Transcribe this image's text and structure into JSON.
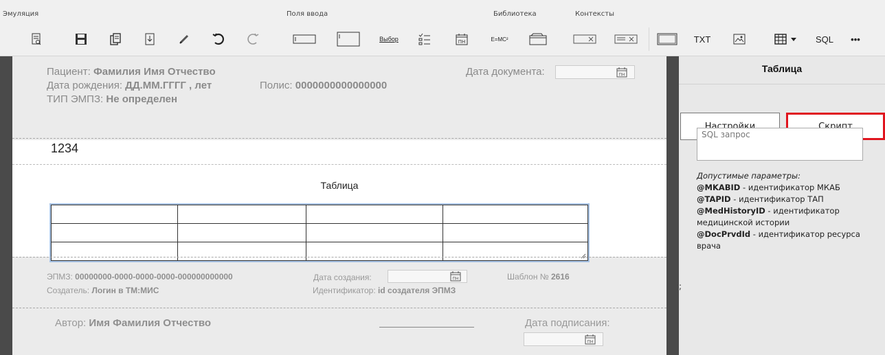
{
  "toolbar": {
    "groups": {
      "emulation": "Эмуляция",
      "input_fields": "Поля ввода",
      "library": "Библиотека",
      "contexts": "Контексты"
    },
    "choice_label": "Выбор",
    "formula_label": "E=MC²",
    "txt_label": "TXT",
    "sql_label": "SQL",
    "more_label": "•••",
    "calendar_glyph": "ПН"
  },
  "document": {
    "patient_label": "Пациент:",
    "patient_value": "Фамилия Имя Отчество",
    "birth_label": "Дата рождения:",
    "birth_value": "ДД.ММ.ГГГГ , лет",
    "policy_label": "Полис:",
    "policy_value": "0000000000000000",
    "emz_type_label": "ТИП ЭМПЗ:",
    "emz_type_value": "Не определен",
    "doc_date_label": "Дата документа:",
    "body_text": "1234",
    "table_caption": "Таблица",
    "table_rows": 3,
    "table_cols": 4
  },
  "footer": {
    "emz_label": "ЭПМЗ:",
    "emz_value": "00000000-0000-0000-0000-000000000000",
    "creator_label": "Создатель:",
    "creator_value": "Логин в ТМ:МИС",
    "created_label": "Дата создания:",
    "identifier_label": "Идентификатор:",
    "identifier_value": "id создателя ЭПМЗ",
    "template_label": "Шаблон №",
    "template_value": "2616",
    "author_label": "Автор:",
    "author_value": "Имя Фамилия Отчество",
    "sign_date_label": "Дата подписания:"
  },
  "panel": {
    "title": "Таблица",
    "tab_settings": "Настройки",
    "tab_script": "Скрипт",
    "sql_placeholder": "SQL запрос",
    "params_caption": "Допустимые параметры:",
    "params": [
      {
        "name": "@MKABID",
        "desc": " - идентификатор МКАБ"
      },
      {
        "name": "@TAPID",
        "desc": " - идентификатор ТАП"
      },
      {
        "name": "@MedHistoryID",
        "desc": " - идентификатор медицинской истории"
      },
      {
        "name": "@DocPrvdId",
        "desc": " - идентификатор ресурса врача"
      }
    ],
    "stray_char": ";"
  },
  "colors": {
    "highlight": "#e0141e",
    "table_border": "#a9c4e6",
    "doc_frame": "#4a4a4a"
  }
}
